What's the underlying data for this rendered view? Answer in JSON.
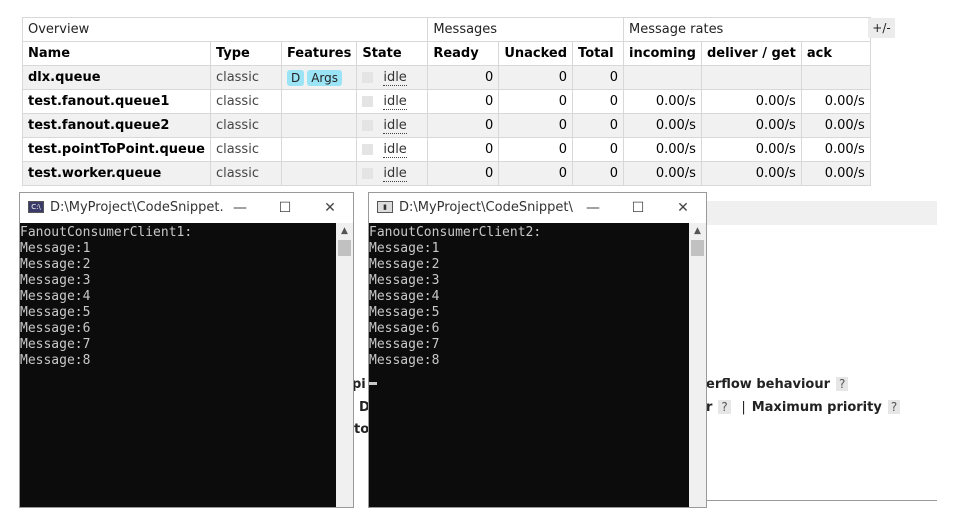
{
  "table": {
    "group_headers": [
      "Overview",
      "Messages",
      "Message rates"
    ],
    "columns": [
      "Name",
      "Type",
      "Features",
      "State",
      "Ready",
      "Unacked",
      "Total",
      "incoming",
      "deliver / get",
      "ack"
    ],
    "toggle_label": "+/-",
    "rows": [
      {
        "name": "dlx.queue",
        "type": "classic",
        "features": [
          "D",
          "Args"
        ],
        "state": "idle",
        "ready": "0",
        "unacked": "0",
        "total": "0",
        "incoming": "",
        "deliver": "",
        "ack": ""
      },
      {
        "name": "test.fanout.queue1",
        "type": "classic",
        "features": [],
        "state": "idle",
        "ready": "0",
        "unacked": "0",
        "total": "0",
        "incoming": "0.00/s",
        "deliver": "0.00/s",
        "ack": "0.00/s"
      },
      {
        "name": "test.fanout.queue2",
        "type": "classic",
        "features": [],
        "state": "idle",
        "ready": "0",
        "unacked": "0",
        "total": "0",
        "incoming": "0.00/s",
        "deliver": "0.00/s",
        "ack": "0.00/s"
      },
      {
        "name": "test.pointToPoint.queue",
        "type": "classic",
        "features": [],
        "state": "idle",
        "ready": "0",
        "unacked": "0",
        "total": "0",
        "incoming": "0.00/s",
        "deliver": "0.00/s",
        "ack": "0.00/s"
      },
      {
        "name": "test.worker.queue",
        "type": "classic",
        "features": [],
        "state": "idle",
        "ready": "0",
        "unacked": "0",
        "total": "0",
        "incoming": "0.00/s",
        "deliver": "0.00/s",
        "ack": "0.00/s"
      }
    ]
  },
  "background": {
    "overflow_label": "erflow behaviour",
    "partial_r": "r",
    "separator": "|",
    "max_priority_label": "Maximum priority",
    "help_mark": "?",
    "frag_pi": "pi",
    "frag_d": "D",
    "frag_to": "to"
  },
  "windows": [
    {
      "title": "D:\\MyProject\\CodeSnippet...",
      "icon": "console-app-icon",
      "lines": [
        "FanoutConsumerClient1:",
        "Message:1",
        "Message:2",
        "Message:3",
        "Message:4",
        "Message:5",
        "Message:6",
        "Message:7",
        "Message:8"
      ]
    },
    {
      "title": "D:\\MyProject\\CodeSnippet\\...",
      "icon": "console-app-icon",
      "lines": [
        "FanoutConsumerClient2:",
        "Message:1",
        "Message:2",
        "Message:3",
        "Message:4",
        "Message:5",
        "Message:6",
        "Message:7",
        "Message:8"
      ]
    }
  ],
  "window_controls": {
    "minimize": "—",
    "maximize": "☐",
    "close": "✕"
  },
  "colors": {
    "feature_badge": "#9be4f6",
    "console_bg": "#0c0c0c",
    "console_text": "#c8c8c8"
  }
}
